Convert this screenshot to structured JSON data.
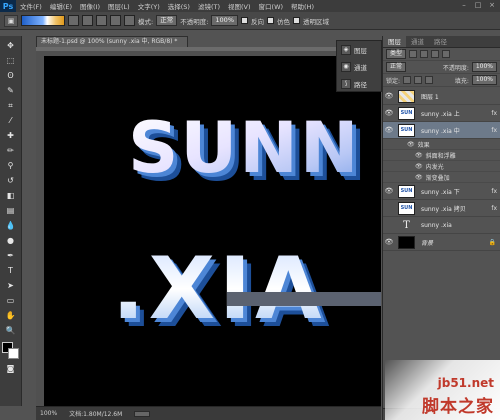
{
  "app": {
    "logo": "Ps"
  },
  "menu": [
    "文件(F)",
    "编辑(E)",
    "图像(I)",
    "图层(L)",
    "文字(Y)",
    "选择(S)",
    "滤镜(T)",
    "视图(V)",
    "窗口(W)",
    "帮助(H)"
  ],
  "window_controls": [
    "–",
    "□",
    "×"
  ],
  "options": {
    "mode_label": "模式:",
    "mode_value": "正常",
    "opacity_label": "不透明度:",
    "opacity_value": "100%",
    "reverse_label": "反向",
    "dither_label": "仿色",
    "transparency_label": "透明区域"
  },
  "document": {
    "tab_title": "未标题-1.psd @ 100% (sunny .xia 中, RGB/8) *",
    "canvas_text_line1": "SUNN",
    "canvas_text_line2": ".XIA"
  },
  "status": {
    "zoom": "100%",
    "doc_info": "文档:1.80M/12.6M"
  },
  "strip": {
    "items": [
      {
        "label": "图层",
        "icon": "layers-icon"
      },
      {
        "label": "通道",
        "icon": "channels-icon"
      },
      {
        "label": "路径",
        "icon": "paths-icon"
      }
    ]
  },
  "panel": {
    "tabs": [
      "图层",
      "通道",
      "路径"
    ],
    "filter_value": "类型",
    "blend_mode": "正常",
    "opacity_label": "不透明度:",
    "opacity_value": "100%",
    "lock_label": "锁定:",
    "fill_label": "填充:",
    "fill_value": "100%",
    "layers": [
      {
        "name": "图层 1",
        "thumb": "yellow",
        "visible": true
      },
      {
        "name": "sunny .xia 上",
        "thumb": "sx",
        "visible": true,
        "fx": "fx"
      },
      {
        "name": "sunny .xia 中",
        "thumb": "sx",
        "visible": true,
        "fx": "fx",
        "selected": true
      },
      {
        "name": "sunny .xia 下",
        "thumb": "sx",
        "visible": true,
        "fx": "fx"
      },
      {
        "name": "sunny .xia 拷贝",
        "thumb": "sx",
        "visible": false,
        "fx": "fx"
      },
      {
        "name": "sunny .xia",
        "thumb": "T",
        "visible": false
      },
      {
        "name": "背景",
        "thumb": "dark",
        "visible": true,
        "lock": "🔒"
      }
    ],
    "effects_label": "效果",
    "effects": [
      "斜面和浮雕",
      "内发光",
      "渐变叠加"
    ]
  },
  "watermark": {
    "url": "jb51.net",
    "cn": "脚本之家"
  }
}
